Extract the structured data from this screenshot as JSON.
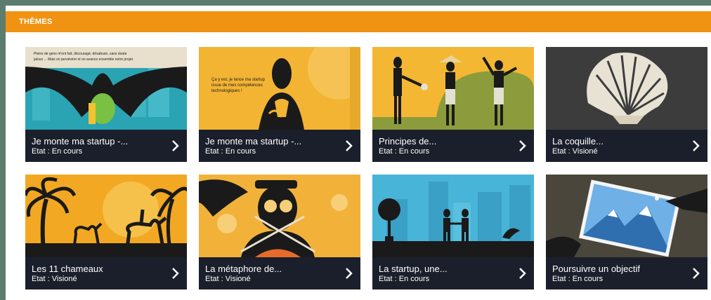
{
  "section": {
    "title": "THÈMES"
  },
  "colors": {
    "header": "#f09312",
    "frame": "#5c7d6e",
    "card_footer": "#1b1f2b"
  },
  "cards": [
    {
      "title": "Je monte ma startup -...",
      "status": "Etat : En cours",
      "overlay": [
        "Pleins de gens m'ont fait, découragé, désabusé, sans doute",
        "jaloux ... Mais on persévère et on avance ensemble notre projet."
      ]
    },
    {
      "title": "Je monte ma startup -...",
      "status": "Etat : En cours",
      "overlay": [
        "Ça y est, je lance ma startup",
        "issue de mes compétences",
        "technologiques !"
      ]
    },
    {
      "title": "Principes de...",
      "status": "Etat : En cours"
    },
    {
      "title": "La coquille...",
      "status": "Etat : Visioné"
    },
    {
      "title": "Les 11 chameaux",
      "status": "Etat : Visioné"
    },
    {
      "title": "La métaphore de...",
      "status": "Etat : Visioné"
    },
    {
      "title": "La startup, une...",
      "status": "Etat : En cours"
    },
    {
      "title": "Poursuivre un objectif",
      "status": "Etat : En cours"
    }
  ]
}
